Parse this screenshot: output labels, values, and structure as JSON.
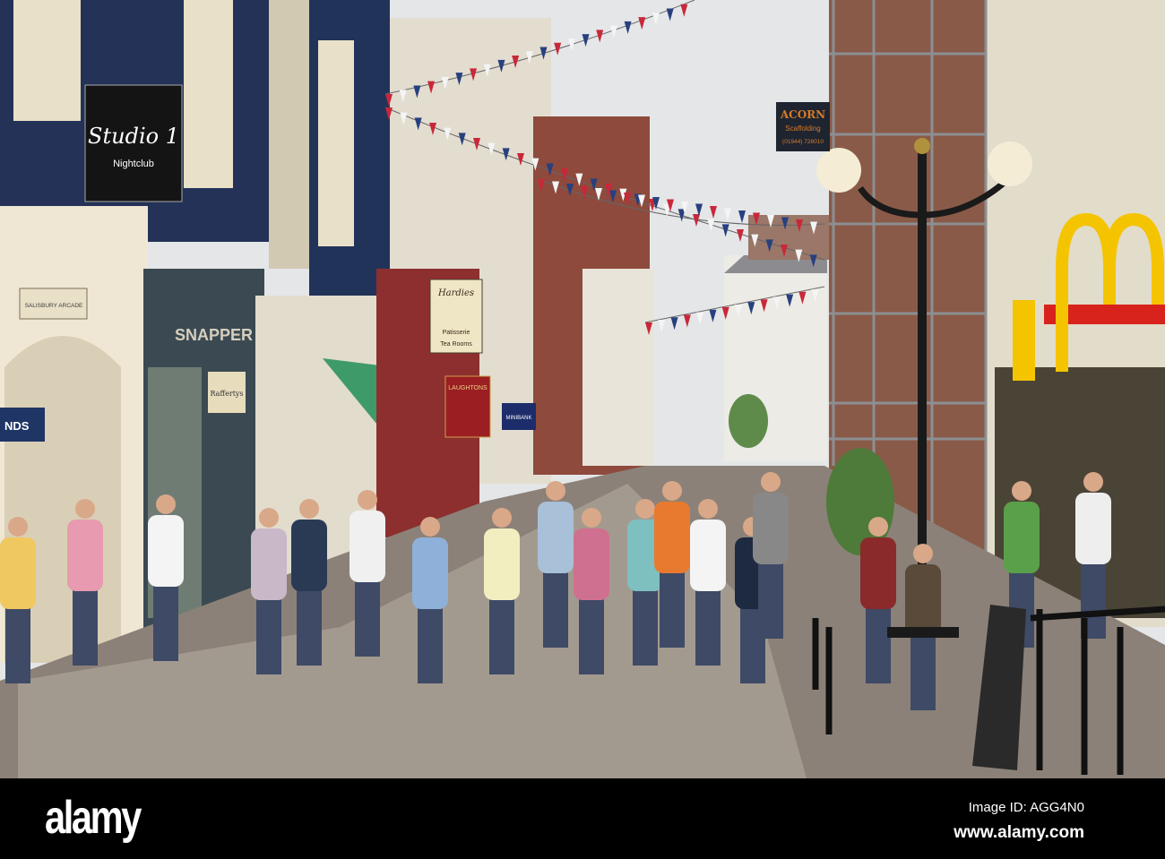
{
  "signs": {
    "studio_title": "Studio 1",
    "studio_sub": "Nightclub",
    "acorn_title": "ACORN",
    "acorn_sub": "Scaffolding",
    "acorn_phone": "(01944) 728010",
    "hardies_title": "Hardies",
    "hardies_sub1": "Patisserie",
    "hardies_sub2": "Tea Rooms",
    "laughtons": "LAUGHTONS",
    "minibank": "MINIBANK",
    "salisbury": "SALISBURY ARCADE",
    "raffertys": "Raffertys",
    "snapper": "SNAPPER",
    "lands": "NDS"
  },
  "watermark": {
    "logo": "alamy",
    "image_id": "Image ID: AGG4N0",
    "url": "www.alamy.com"
  },
  "colors": {
    "sky": "#e6e8ea",
    "navy": "#1f2f55",
    "mcd_red": "#d8231c",
    "mcd_yellow": "#f5c400"
  }
}
